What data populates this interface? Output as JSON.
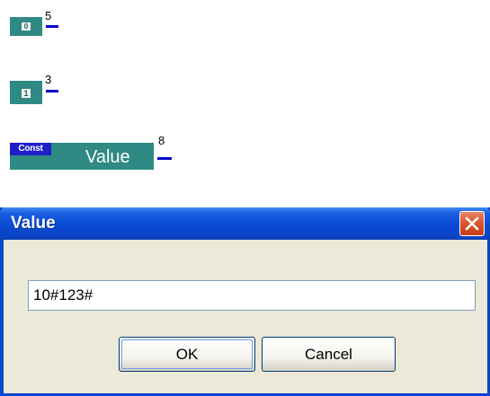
{
  "blocks": [
    {
      "inner_label": "0",
      "pin_number": "5"
    },
    {
      "inner_label": "1",
      "pin_number": "3"
    },
    {
      "tag": "Const",
      "label": "Value",
      "pin_number": "8"
    }
  ],
  "dialog": {
    "title": "Value",
    "input_value": "10#123#",
    "ok_label": "OK",
    "cancel_label": "Cancel"
  },
  "colors": {
    "block_teal": "#2e8a83",
    "const_tag_blue": "#1e1ec8",
    "pin_line_blue": "#0000cc",
    "title_bar_blue": "#0a4bd4",
    "close_red": "#d9572c"
  },
  "icons": {
    "close": "close-icon"
  }
}
